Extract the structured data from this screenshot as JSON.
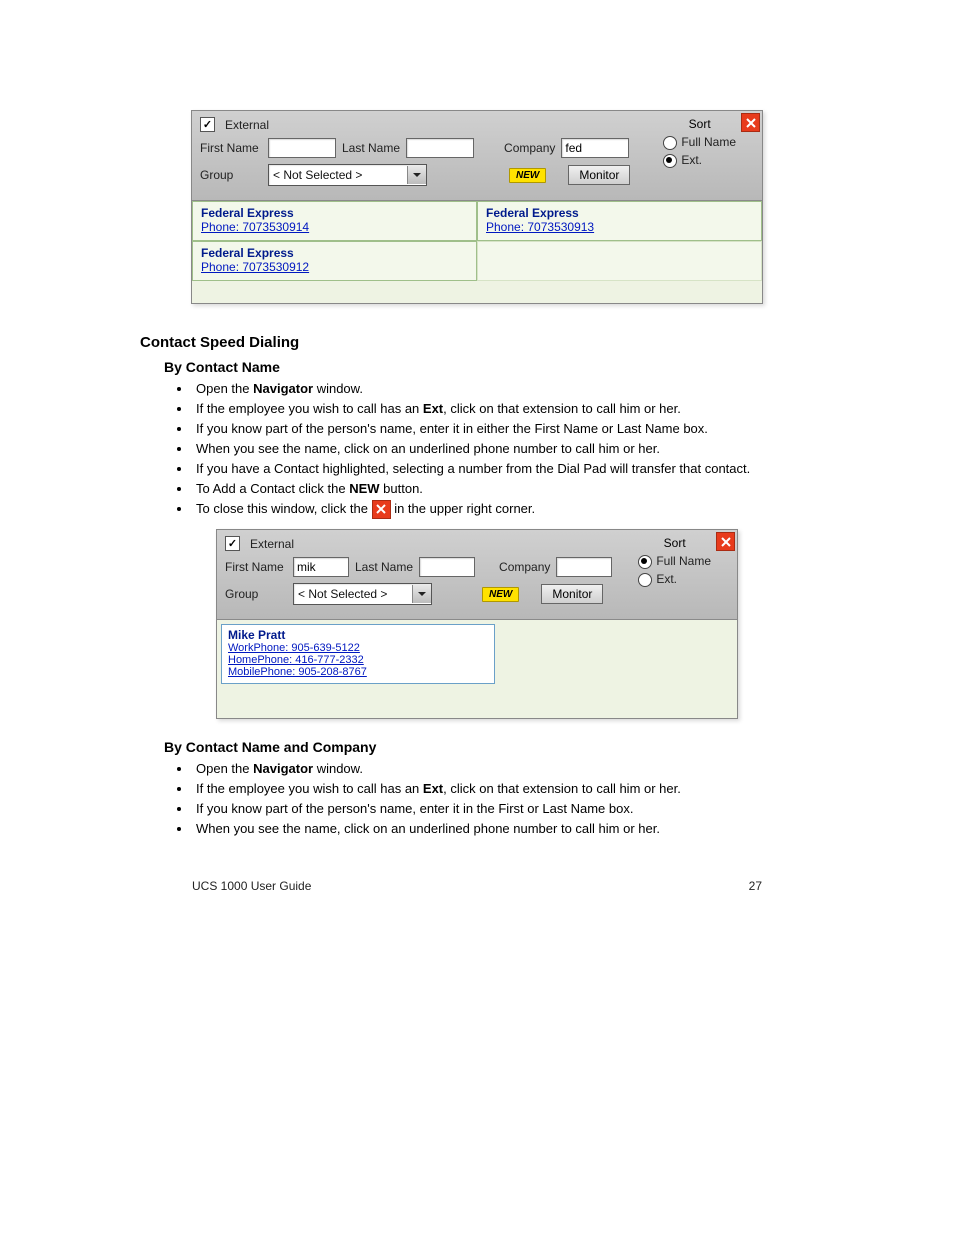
{
  "panel1": {
    "external_label": "External",
    "firstname_label": "First Name",
    "firstname_value": "",
    "lastname_label": "Last Name",
    "lastname_value": "",
    "company_label": "Company",
    "company_value": "fed",
    "group_label": "Group",
    "group_value": "< Not Selected >",
    "new_label": "NEW",
    "monitor_label": "Monitor",
    "sort_label": "Sort",
    "sort_fullname": "Full Name",
    "sort_ext": "Ext.",
    "results": [
      {
        "title": "Federal Express",
        "phone_label": "Phone: 7073530914"
      },
      {
        "title": "Federal Express",
        "phone_label": "Phone: 7073530913"
      },
      {
        "title": "Federal Express",
        "phone_label": "Phone: 7073530912"
      }
    ]
  },
  "panel2": {
    "external_label": "External",
    "firstname_label": "First Name",
    "firstname_value": "mik",
    "lastname_label": "Last Name",
    "lastname_value": "",
    "company_label": "Company",
    "company_value": "",
    "group_label": "Group",
    "group_value": "< Not Selected >",
    "new_label": "NEW",
    "monitor_label": "Monitor",
    "sort_label": "Sort",
    "sort_fullname": "Full Name",
    "sort_ext": "Ext.",
    "card": {
      "title": "Mike Pratt",
      "work": "WorkPhone: 905-639-5122",
      "home": "HomePhone: 416-777-2332",
      "mobile": "MobilePhone: 905-208-8767"
    }
  },
  "doc": {
    "h2": "Contact Speed Dialing",
    "h3a": "By Contact Name",
    "bulletsA": {
      "b1a": "Open the ",
      "b1b": "Navigator",
      "b1c": " window.",
      "b2a": "If the employee you wish to call has an ",
      "b2b": "Ext",
      "b2c": ", click on that extension to call him or her.",
      "b3": "If you know part of the person's name, enter it in either the First Name or Last Name box.",
      "b4": "When you see the name, click on an underlined phone number to call him or her.",
      "b5": "If you have a Contact highlighted, selecting a number from the Dial Pad will transfer that contact.",
      "b6a": "To Add a Contact click the ",
      "b6b": "NEW",
      "b6c": " button.",
      "b7a": "To close this window, click the ",
      "b7b": " in the upper right corner."
    },
    "h3b": "By Contact Name and Company",
    "bulletsB": {
      "b1a": "Open the ",
      "b1b": "Navigator",
      "b1c": " window.",
      "b2a": "If the employee you wish to call has an ",
      "b2b": "Ext",
      "b2c": ", click on that extension to call him or her.",
      "b3": "If you know part of the person's name, enter it in the First or Last Name box.",
      "b4": "When you see the name, click on an underlined phone number to call him or her."
    },
    "footer_left": "UCS 1000 User Guide",
    "footer_right": "27"
  }
}
